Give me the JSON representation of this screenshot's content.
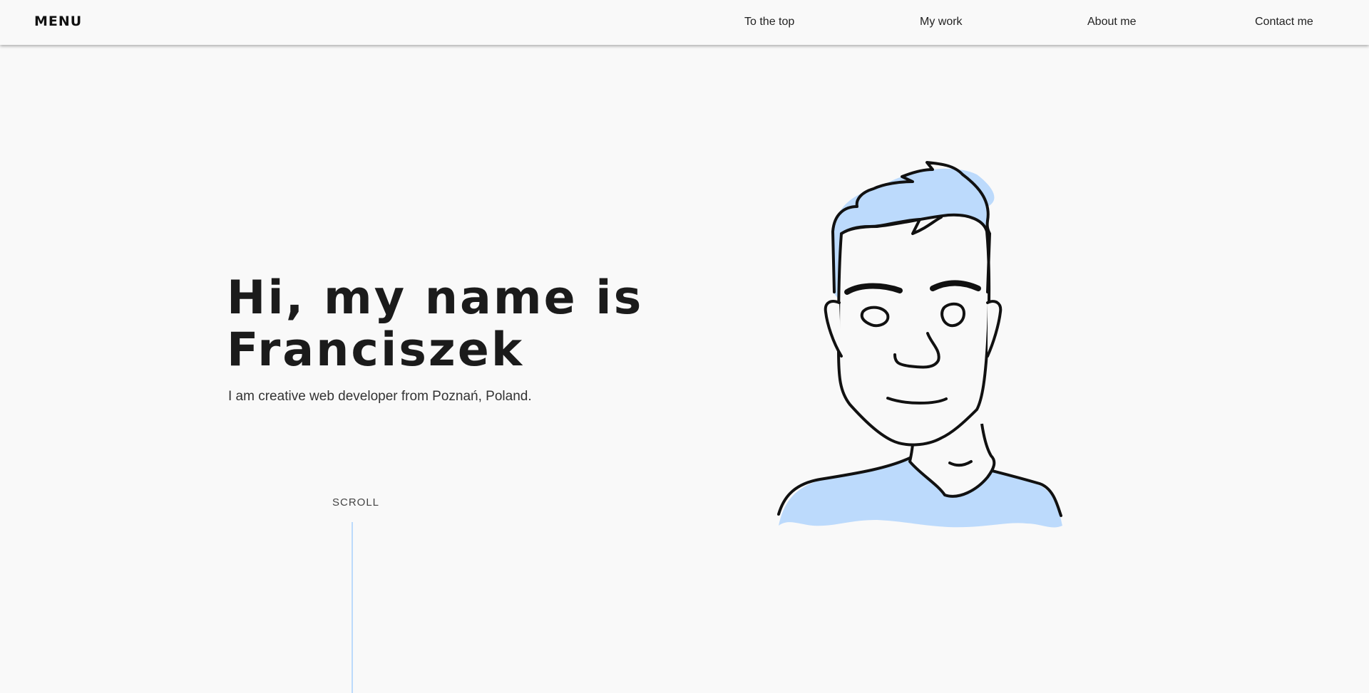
{
  "nav": {
    "menu_label": "MENU",
    "links": [
      "To the top",
      "My work",
      "About me",
      "Contact me"
    ]
  },
  "hero": {
    "title_line1": "Hi, my name is",
    "title_line2": "Franciszek",
    "subtitle": "I am creative web developer from Poznań, Poland."
  },
  "scroll": {
    "label": "SCROLL"
  },
  "colors": {
    "background": "#f9f9f9",
    "accent": "#bcdafc",
    "text": "#1b1b1b"
  },
  "icons": {
    "avatar": "avatar-illustration"
  }
}
